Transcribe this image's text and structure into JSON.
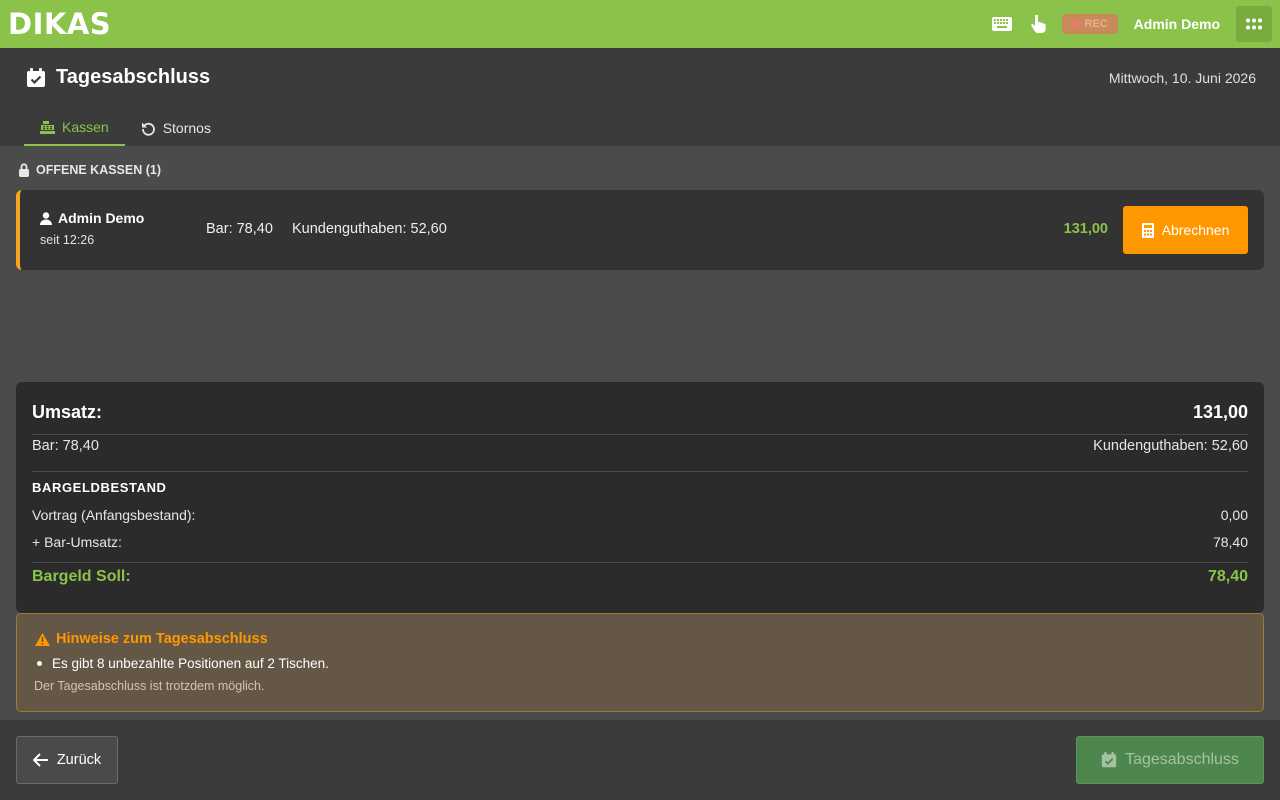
{
  "app": {
    "logo_text": "DIKAS",
    "brand_color": "#8bc34a",
    "accent_color": "#ff9800",
    "header_icons": [
      "keyboard-icon",
      "touch-hand-icon"
    ],
    "rec_badge_text": "REC",
    "user_name": "Admin Demo",
    "apps_icon": "grid-icon"
  },
  "page": {
    "title": "Tagesabschluss",
    "title_icon": "calendar-check-icon",
    "date": "Mittwoch, 10. Juni 2026"
  },
  "tabs": [
    {
      "label": "Kassen",
      "icon": "cash-register-icon",
      "active": true
    },
    {
      "label": "Stornos",
      "icon": "undo-icon",
      "active": false
    }
  ],
  "open_registers": {
    "section_label": "OFFENE KASSEN (1)",
    "items": [
      {
        "user": "Admin Demo",
        "since": "seit 12:26",
        "bar": "Bar: 78,40",
        "kundenguthaben": "Kundenguthaben: 52,60",
        "total": "131,00",
        "action_label": "Abrechnen"
      }
    ]
  },
  "summary": {
    "umsatz_label": "Umsatz:",
    "umsatz_value": "131,00",
    "bar": "Bar: 78,40",
    "kundenguthaben": "Kundenguthaben: 52,60",
    "bargeld_heading": "BARGELDBESTAND",
    "vortrag_label": "Vortrag (Anfangsbestand):",
    "vortrag_value": "0,00",
    "bar_umsatz_label": "+ Bar-Umsatz:",
    "bar_umsatz_value": "78,40",
    "soll_label": "Bargeld Soll:",
    "soll_value": "78,40"
  },
  "hint": {
    "title": "Hinweise zum Tagesabschluss",
    "items": [
      "Es gibt 8 unbezahlte Positionen auf 2 Tischen."
    ],
    "note": "Der Tagesabschluss ist trotzdem möglich."
  },
  "footer": {
    "back_label": "Zurück",
    "close_label": "Tagesabschluss"
  }
}
